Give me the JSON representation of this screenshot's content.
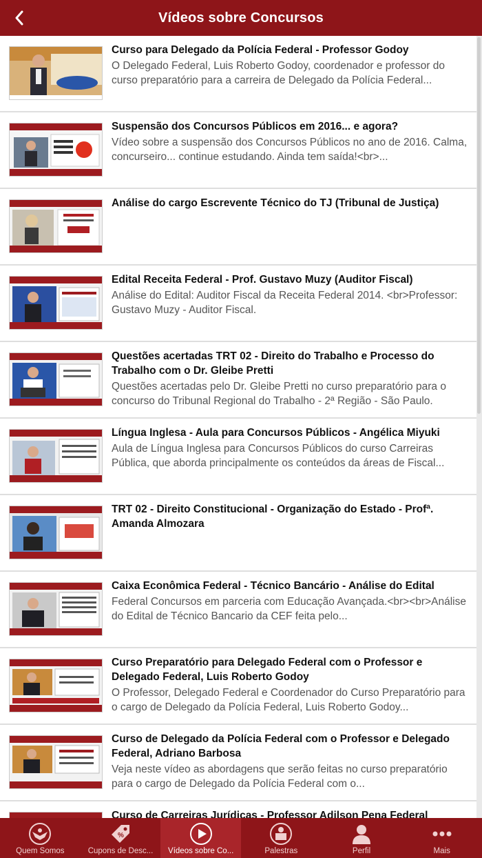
{
  "header": {
    "title": "Vídeos sobre Concursos"
  },
  "videos": [
    {
      "title": "Curso para Delegado da Polícia Federal - Professor Godoy",
      "description": "O Delegado Federal, Luis Roberto Godoy, coordenador e professor do curso preparatório para a carreira de Delegado da Polícia Federal..."
    },
    {
      "title": "Suspensão dos Concursos Públicos em 2016... e agora?",
      "description": "Vídeo sobre a suspensão dos Concursos Públicos no ano de 2016. Calma, concurseiro... continue estudando. Ainda tem saída!<br>..."
    },
    {
      "title": "Análise do cargo Escrevente Técnico do TJ (Tribunal de Justiça)",
      "description": ""
    },
    {
      "title": "Edital Receita Federal - Prof. Gustavo Muzy (Auditor Fiscal)",
      "description": "Análise do Edital: Auditor Fiscal da Receita Federal 2014. <br>Professor: Gustavo Muzy - Auditor Fiscal."
    },
    {
      "title": "Questões acertadas TRT 02 - Direito do Trabalho e Processo do Trabalho com o Dr. Gleibe Pretti",
      "description": "Questões acertadas pelo Dr. Gleibe Pretti no curso preparatório para o concurso do Tribunal Regional do Trabalho - 2ª Região - São Paulo."
    },
    {
      "title": "Língua Inglesa - Aula para Concursos Públicos - Angélica Miyuki",
      "description": "Aula de Língua Inglesa para Concursos Públicos do curso Carreiras Pública, que aborda principalmente os conteúdos da áreas de Fiscal..."
    },
    {
      "title": "TRT 02 - Direito Constitucional - Organização do Estado - Profª. Amanda Almozara",
      "description": ""
    },
    {
      "title": "Caixa Econômica Federal - Técnico Bancário - Análise do Edital",
      "description": "Federal Concursos em parceria com Educação Avançada.<br><br>Análise do Edital de Técnico Bancario da CEF feita pelo..."
    },
    {
      "title": "Curso Preparatório para Delegado Federal com o Professor e Delegado Federal, Luis Roberto Godoy",
      "description": "O Professor, Delegado Federal e Coordenador do Curso Preparatório para o cargo de Delegado da Polícia Federal, Luis Roberto Godoy..."
    },
    {
      "title": "Curso de Delegado da Polícia Federal com o Professor e Delegado Federal, Adriano Barbosa",
      "description": "Veja neste vídeo as abordagens que serão feitas no curso preparatório para o cargo de Delegado da Polícia Federal com o..."
    },
    {
      "title": "Curso de Carreiras Jurídicas - Professor Adilson Pena Federal",
      "description": ""
    }
  ],
  "tabbar": {
    "tabs": [
      {
        "label": "Quem Somos",
        "icon": "eagle-badge-icon"
      },
      {
        "label": "Cupons de Desc...",
        "icon": "discount-tag-icon"
      },
      {
        "label": "Vídeos sobre Co...",
        "icon": "play-icon",
        "active": true
      },
      {
        "label": "Palestras",
        "icon": "presenter-icon"
      },
      {
        "label": "Perfil",
        "icon": "person-icon"
      },
      {
        "label": "Mais",
        "icon": "more-dots-icon"
      }
    ]
  },
  "colors": {
    "brand": "#8e1519",
    "brand_active": "#a9252a"
  }
}
